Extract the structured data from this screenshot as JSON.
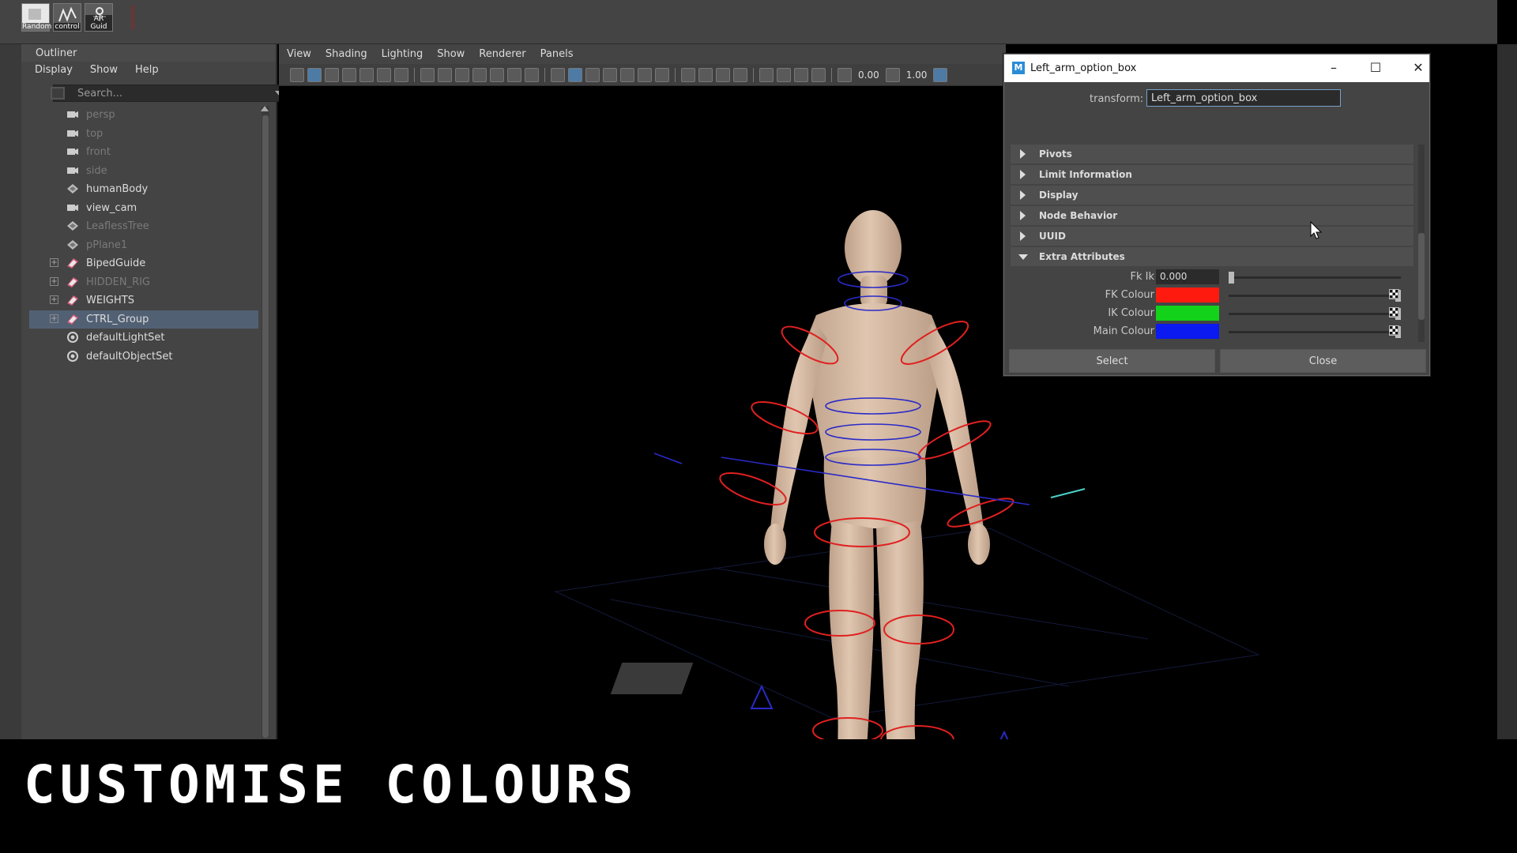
{
  "shelf": {
    "items": [
      {
        "label": "Random",
        "icon": "random-tool-icon"
      },
      {
        "label": "control",
        "icon": "control-tool-icon"
      },
      {
        "label": "AR Guid",
        "icon": "ar-guide-tool-icon"
      }
    ]
  },
  "outliner": {
    "title": "Outliner",
    "menu": [
      "Display",
      "Show",
      "Help"
    ],
    "search_placeholder": "Search...",
    "items": [
      {
        "label": "persp",
        "icon": "camera-icon",
        "dim": true,
        "expandable": false
      },
      {
        "label": "top",
        "icon": "camera-icon",
        "dim": true,
        "expandable": false
      },
      {
        "label": "front",
        "icon": "camera-icon",
        "dim": true,
        "expandable": false
      },
      {
        "label": "side",
        "icon": "camera-icon",
        "dim": true,
        "expandable": false
      },
      {
        "label": "humanBody",
        "icon": "mesh-icon",
        "dim": false,
        "expandable": false
      },
      {
        "label": "view_cam",
        "icon": "camera-icon",
        "dim": false,
        "expandable": false
      },
      {
        "label": "LeaflessTree",
        "icon": "mesh-icon",
        "dim": true,
        "expandable": false
      },
      {
        "label": "pPlane1",
        "icon": "mesh-icon",
        "dim": true,
        "expandable": false
      },
      {
        "label": "BipedGuide",
        "icon": "group-icon",
        "dim": false,
        "expandable": true
      },
      {
        "label": "HIDDEN_RIG",
        "icon": "group-icon",
        "dim": true,
        "expandable": true
      },
      {
        "label": "WEIGHTS",
        "icon": "group-icon",
        "dim": false,
        "expandable": true
      },
      {
        "label": "CTRL_Group",
        "icon": "group-icon",
        "dim": false,
        "expandable": true,
        "selected": true
      },
      {
        "label": "defaultLightSet",
        "icon": "set-icon",
        "dim": false,
        "expandable": false
      },
      {
        "label": "defaultObjectSet",
        "icon": "set-icon",
        "dim": false,
        "expandable": false
      }
    ]
  },
  "viewport": {
    "menu": [
      "View",
      "Shading",
      "Lighting",
      "Show",
      "Renderer",
      "Panels"
    ],
    "toolbar_value_1": "0.00",
    "toolbar_value_2": "1.00"
  },
  "dialog": {
    "title": "Left_arm_option_box",
    "transform_label": "transform:",
    "transform_value": "Left_arm_option_box",
    "sections": [
      {
        "label": "Pivots",
        "open": false
      },
      {
        "label": "Limit Information",
        "open": false
      },
      {
        "label": "Display",
        "open": false
      },
      {
        "label": "Node Behavior",
        "open": false
      },
      {
        "label": "UUID",
        "open": false
      },
      {
        "label": "Extra Attributes",
        "open": true
      }
    ],
    "attributes": {
      "fk_ik_label": "Fk Ik",
      "fk_ik_value": "0.000",
      "fk_ik_slider": 0.0,
      "fk_colour_label": "FK Colour",
      "fk_colour": "#ff1a10",
      "fk_colour_slider": 1.0,
      "ik_colour_label": "IK Colour",
      "ik_colour": "#12d21a",
      "ik_colour_slider": 1.0,
      "main_colour_label": "Main Colour",
      "main_colour": "#0a1af0",
      "main_colour_slider": 1.0
    },
    "buttons": {
      "select": "Select",
      "close": "Close"
    }
  },
  "caption": "CUSTOMISE COLOURS",
  "colors": {
    "panel": "#444444",
    "selection": "#526074",
    "rig_red": "#e02020",
    "rig_blue": "#2a2ac8",
    "skin": "#d9bca4"
  }
}
